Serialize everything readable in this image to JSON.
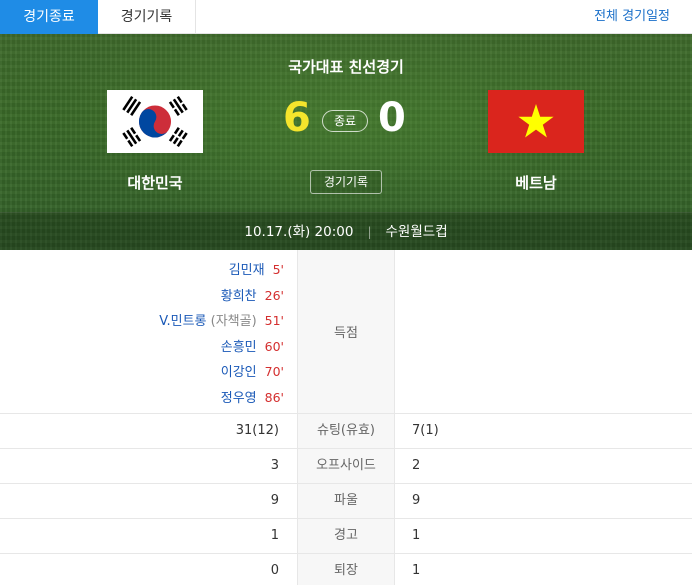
{
  "tabs": {
    "active": "경기종료",
    "record": "경기기록",
    "all_schedule": "전체 경기일정"
  },
  "match": {
    "title": "국가대표 친선경기",
    "status": "종료",
    "record_button": "경기기록",
    "date_time": "10.17.(화) 20:00",
    "separator": "|",
    "stadium": "수원월드컵"
  },
  "home": {
    "name": "대한민국",
    "score": "6",
    "flag_icon": "korea-flag-icon"
  },
  "away": {
    "name": "베트남",
    "score": "0",
    "flag_icon": "vietnam-flag-icon"
  },
  "colors": {
    "tab_active": "#1f8ce6",
    "home_score": "#f5e52c",
    "goal_minute": "#d42f2f",
    "player_name": "#1a59b7",
    "vietnam_red": "#da251d",
    "vietnam_star": "#ffff00"
  },
  "goals": {
    "label": "득점",
    "scorers": [
      {
        "name": "김민재",
        "note": "",
        "minute": "5'"
      },
      {
        "name": "황희찬",
        "note": "",
        "minute": "26'"
      },
      {
        "name": "V.민트롱",
        "note": " (자책골)",
        "minute": "51'"
      },
      {
        "name": "손흥민",
        "note": "",
        "minute": "60'"
      },
      {
        "name": "이강인",
        "note": "",
        "minute": "70'"
      },
      {
        "name": "정우영",
        "note": "",
        "minute": "86'"
      }
    ]
  },
  "stats": [
    {
      "label": "슈팅(유효)",
      "home": "31(12)",
      "away": "7(1)"
    },
    {
      "label": "오프사이드",
      "home": "3",
      "away": "2"
    },
    {
      "label": "파울",
      "home": "9",
      "away": "9"
    },
    {
      "label": "경고",
      "home": "1",
      "away": "1"
    },
    {
      "label": "퇴장",
      "home": "0",
      "away": "1"
    }
  ]
}
